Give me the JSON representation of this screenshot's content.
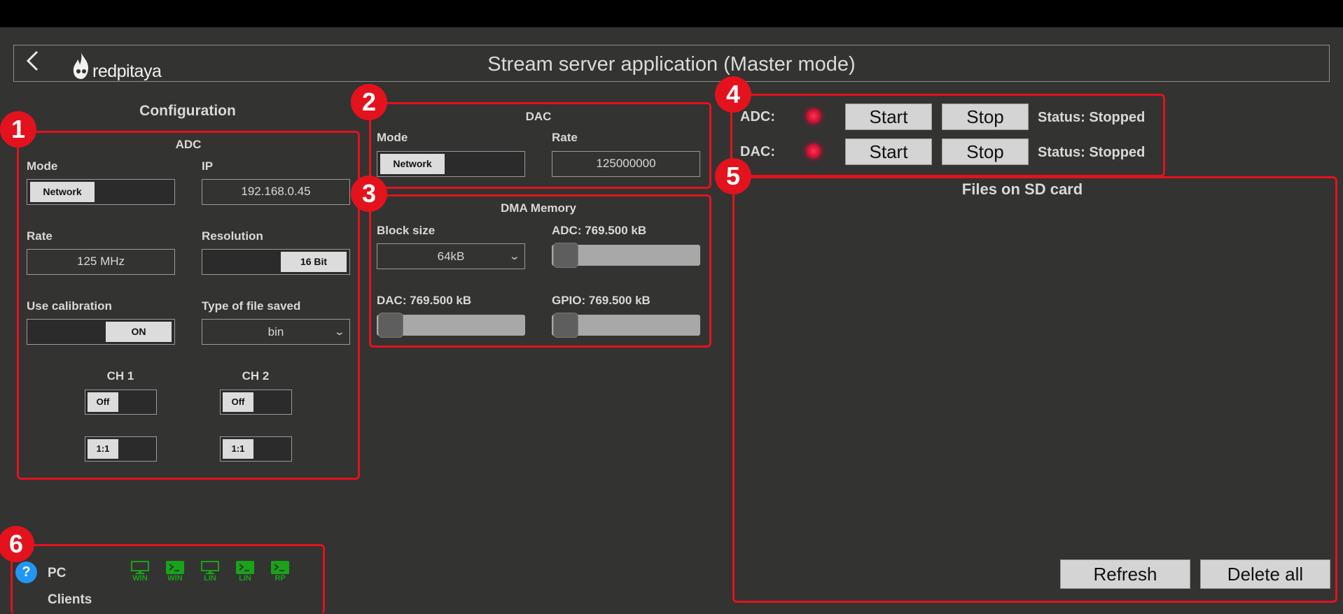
{
  "header": {
    "title": "Stream server application (Master mode)",
    "logo_text": "redpitaya"
  },
  "callouts": [
    "1",
    "2",
    "3",
    "4",
    "5",
    "6"
  ],
  "config": {
    "title": "Configuration",
    "adc": {
      "title": "ADC",
      "mode_label": "Mode",
      "mode_value": "Network",
      "ip_label": "IP",
      "ip_value": "192.168.0.45",
      "rate_label": "Rate",
      "rate_value": "125 MHz",
      "resolution_label": "Resolution",
      "resolution_value": "16 Bit",
      "calib_label": "Use calibration",
      "calib_value": "ON",
      "filetype_label": "Type of file saved",
      "filetype_value": "bin",
      "ch1_label": "CH 1",
      "ch2_label": "CH 2",
      "ch1_state": "Off",
      "ch2_state": "Off",
      "ch1_atten": "1:1",
      "ch2_atten": "1:1"
    }
  },
  "dac": {
    "title": "DAC",
    "mode_label": "Mode",
    "mode_value": "Network",
    "rate_label": "Rate",
    "rate_value": "125000000"
  },
  "dma": {
    "title": "DMA Memory",
    "block_label": "Block size",
    "block_value": "64kB",
    "adc_label": "ADC: 769.500 kB",
    "dac_label": "DAC: 769.500 kB",
    "gpio_label": "GPIO: 769.500 kB",
    "adc_level": 0,
    "dac_level": 0,
    "gpio_level": 0
  },
  "control": {
    "adc_label": "ADC:",
    "dac_label": "DAC:",
    "start_label": "Start",
    "stop_label": "Stop",
    "adc_status": "Status: Stopped",
    "dac_status": "Status: Stopped",
    "led_color": "#e3121d"
  },
  "files": {
    "title": "Files on SD card",
    "refresh_label": "Refresh",
    "delete_label": "Delete all"
  },
  "clients": {
    "help": "?",
    "pc_label": "PC",
    "clients_label": "Clients",
    "items": [
      {
        "label": "WIN",
        "icon": "monitor-icon"
      },
      {
        "label": "WIN",
        "icon": "terminal-icon"
      },
      {
        "label": "LIN",
        "icon": "monitor-icon"
      },
      {
        "label": "LIN",
        "icon": "terminal-icon"
      },
      {
        "label": "RP",
        "icon": "terminal-icon"
      }
    ]
  },
  "colors": {
    "accent_red": "#e3121d",
    "background": "#333332",
    "client_green": "#19a319",
    "help_blue": "#2196f3"
  }
}
